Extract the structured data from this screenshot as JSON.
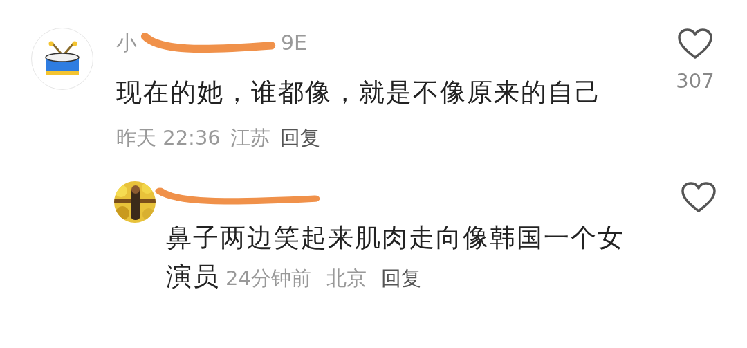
{
  "comments": [
    {
      "avatar": {
        "kind": "icon"
      },
      "username_parts": [
        "小",
        "9E"
      ],
      "redacted": true,
      "text": "现在的她，谁都像，就是不像原来的自己",
      "time": "昨天 22:36",
      "location": "江苏",
      "reply_label": "回复",
      "liked": false,
      "like_count": "307",
      "children": [
        {
          "redacted": true,
          "text": "鼻子两边笑起来肌肉走向像韩国一个女",
          "text_wrap": "演员",
          "time": "24分钟前",
          "location": "北京",
          "reply_label": "回复",
          "liked": false
        }
      ]
    }
  ]
}
